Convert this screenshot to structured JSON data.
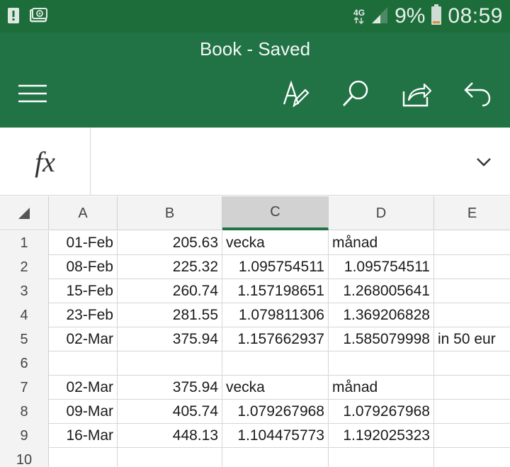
{
  "status_bar": {
    "network_label": "4G",
    "battery_percent": "9%",
    "time": "08:59",
    "icons": [
      "alert-icon",
      "screencast-icon",
      "signal-icon",
      "battery-icon"
    ]
  },
  "app": {
    "title": "Book - Saved",
    "accent_color": "#217346",
    "toolbar": [
      "menu-icon",
      "draw-icon",
      "search-icon",
      "share-icon",
      "undo-icon"
    ]
  },
  "formula_bar": {
    "fx_label": "fx",
    "value": ""
  },
  "grid": {
    "columns": [
      "A",
      "B",
      "C",
      "D",
      "E"
    ],
    "selected_column": "C",
    "rows": [
      {
        "num": "1",
        "cells": [
          "01-Feb",
          "205.63",
          "vecka",
          "månad",
          ""
        ]
      },
      {
        "num": "2",
        "cells": [
          "08-Feb",
          "225.32",
          "1.095754511",
          "1.095754511",
          ""
        ]
      },
      {
        "num": "3",
        "cells": [
          "15-Feb",
          "260.74",
          "1.157198651",
          "1.268005641",
          ""
        ]
      },
      {
        "num": "4",
        "cells": [
          "23-Feb",
          "281.55",
          "1.079811306",
          "1.369206828",
          ""
        ]
      },
      {
        "num": "5",
        "cells": [
          "02-Mar",
          "375.94",
          "1.157662937",
          "1.585079998",
          "in 50 eur"
        ]
      },
      {
        "num": "6",
        "cells": [
          "",
          "",
          "",
          "",
          ""
        ]
      },
      {
        "num": "7",
        "cells": [
          "02-Mar",
          "375.94",
          "vecka",
          "månad",
          ""
        ]
      },
      {
        "num": "8",
        "cells": [
          "09-Mar",
          "405.74",
          "1.079267968",
          "1.079267968",
          ""
        ]
      },
      {
        "num": "9",
        "cells": [
          "16-Mar",
          "448.13",
          "1.104475773",
          "1.192025323",
          ""
        ]
      },
      {
        "num": "10",
        "cells": [
          "",
          "",
          "",
          "",
          ""
        ]
      }
    ]
  }
}
